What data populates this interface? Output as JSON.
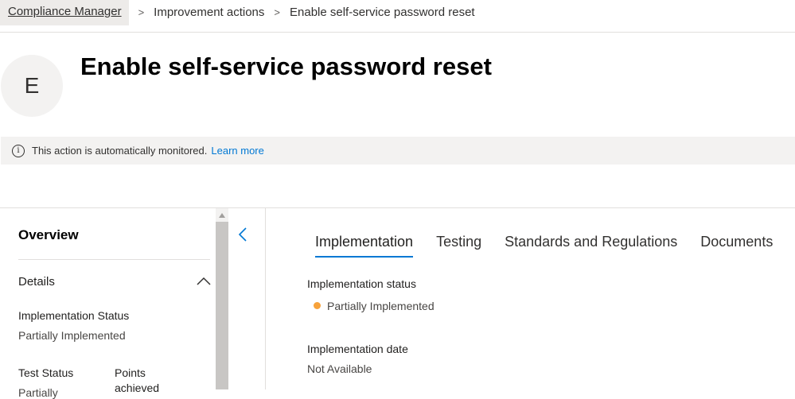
{
  "breadcrumb": {
    "items": [
      "Compliance Manager",
      "Improvement actions",
      "Enable self-service password reset"
    ],
    "separator": ">"
  },
  "header": {
    "avatar_letter": "E",
    "title": "Enable self-service password reset"
  },
  "info_bar": {
    "icon": "info-icon",
    "message": "This action is automatically monitored.",
    "link_text": "Learn more"
  },
  "left_panel": {
    "overview_title": "Overview",
    "details_label": "Details",
    "details_expanded": true,
    "implementation_status_label": "Implementation Status",
    "implementation_status_value": "Partially Implemented",
    "test_status_label": "Test Status",
    "test_status_value": "Partially",
    "points_label_line1": "Points",
    "points_label_line2": "achieved"
  },
  "tabs": [
    {
      "label": "Implementation",
      "active": true
    },
    {
      "label": "Testing",
      "active": false
    },
    {
      "label": "Standards and Regulations",
      "active": false
    },
    {
      "label": "Documents",
      "active": false
    }
  ],
  "implementation": {
    "status_label": "Implementation status",
    "status_value": "Partially Implemented",
    "status_color": "#f7a23b",
    "date_label": "Implementation date",
    "date_value": "Not Available"
  },
  "colors": {
    "accent": "#0078d4",
    "info_bar_bg": "#f3f2f1"
  }
}
